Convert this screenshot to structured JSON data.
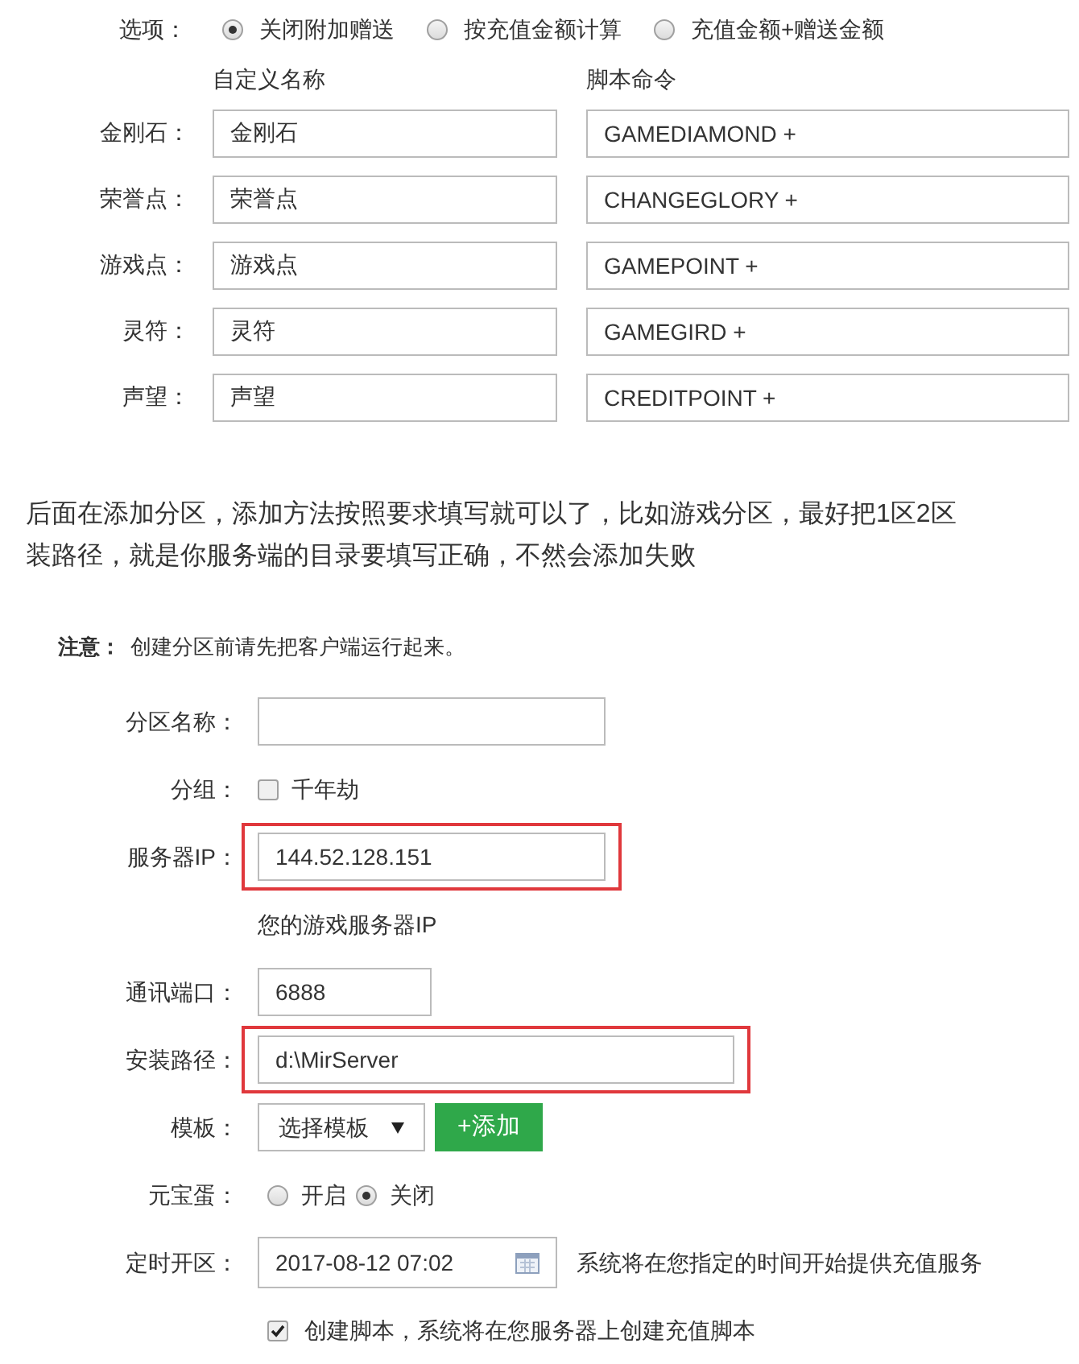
{
  "options": {
    "label": "选项：",
    "choices": [
      {
        "label": "关闭附加赠送",
        "selected": true
      },
      {
        "label": "按充值金额计算",
        "selected": false
      },
      {
        "label": "充值金额+赠送金额",
        "selected": false
      }
    ]
  },
  "currency_table": {
    "columns": [
      "自定义名称",
      "脚本命令"
    ],
    "rows": [
      {
        "label": "金刚石：",
        "name": "金刚石",
        "command": "GAMEDIAMOND +"
      },
      {
        "label": "荣誉点：",
        "name": "荣誉点",
        "command": "CHANGEGLORY +"
      },
      {
        "label": "游戏点：",
        "name": "游戏点",
        "command": "GAMEPOINT +"
      },
      {
        "label": "灵符：",
        "name": "灵符",
        "command": "GAMEGIRD +"
      },
      {
        "label": "声望：",
        "name": "声望",
        "command": "CREDITPOINT +"
      }
    ]
  },
  "paragraph_lines": [
    "后面在添加分区，添加方法按照要求填写就可以了，比如游戏分区，最好把1区2区",
    "装路径，就是你服务端的目录要填写正确，不然会添加失败"
  ],
  "form": {
    "note_label": "注意：",
    "note": "创建分区前请先把客户端运行起来。",
    "fields": [
      {
        "kind": "text",
        "label": "分区名称："
      },
      {
        "kind": "checkbox_group",
        "label": "分组：",
        "options": [
          {
            "label": "千年劫",
            "checked": false
          }
        ]
      },
      {
        "kind": "text",
        "label": "服务器IP：",
        "value": "144.52.128.151",
        "highlighted": true
      },
      {
        "kind": "hint",
        "text": "您的游戏服务器IP"
      },
      {
        "kind": "short_text",
        "label": "通讯端口：",
        "value": "6888"
      },
      {
        "kind": "long_text",
        "label": "安装路径：",
        "value": "d:\\MirServer",
        "highlighted": true
      },
      {
        "kind": "select",
        "label": "模板：",
        "value": "选择模板",
        "button": "+添加"
      },
      {
        "kind": "radio",
        "label": "元宝蛋：",
        "choices": [
          {
            "label": "开启",
            "selected": false
          },
          {
            "label": "关闭",
            "selected": true
          }
        ]
      },
      {
        "kind": "datetime",
        "label": "定时开区：",
        "value": "2017-08-12 07:02",
        "note": "系统将在您指定的时间开始提供充值服务"
      },
      {
        "kind": "checkbox",
        "text": "创建脚本，系统将在您服务器上创建充值脚本",
        "checked": true
      }
    ]
  }
}
